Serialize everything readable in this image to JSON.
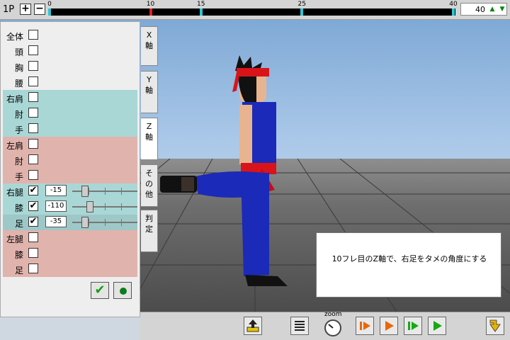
{
  "player": "1P",
  "zoom_in_label": "+",
  "zoom_out_label": "−",
  "timeline": {
    "ticks": [
      {
        "label": "0",
        "frame": 0,
        "color": "#2ec5d6"
      },
      {
        "label": "10",
        "frame": 10,
        "color": "#e02020"
      },
      {
        "label": "15",
        "frame": 15,
        "color": "#2ec5d6"
      },
      {
        "label": "25",
        "frame": 25,
        "color": "#2ec5d6"
      },
      {
        "label": "40",
        "frame": 40,
        "color": "#2ec5d6"
      }
    ],
    "current_frame": "40"
  },
  "panel": {
    "rows": [
      {
        "label": "全体",
        "checked": false
      },
      {
        "label": "頭",
        "checked": false
      },
      {
        "label": "胸",
        "checked": false
      },
      {
        "label": "腰",
        "checked": false
      },
      {
        "label": "右肩",
        "checked": false
      },
      {
        "label": "肘",
        "checked": false
      },
      {
        "label": "手",
        "checked": false
      },
      {
        "label": "左肩",
        "checked": false
      },
      {
        "label": "肘",
        "checked": false
      },
      {
        "label": "手",
        "checked": false
      },
      {
        "label": "右腿",
        "checked": true,
        "value": "-15",
        "slider_fraction": 0.2
      },
      {
        "label": "膝",
        "checked": true,
        "value": "-110",
        "slider_fraction": 0.27
      },
      {
        "label": "足",
        "checked": true,
        "value": "-35",
        "slider_fraction": 0.2
      },
      {
        "label": "左腿",
        "checked": false
      },
      {
        "label": "膝",
        "checked": false
      },
      {
        "label": "足",
        "checked": false
      }
    ],
    "confirm_icon": "checkmark-icon",
    "record_icon": "record-dot-icon"
  },
  "axis_tabs": [
    "X\n軸",
    "Y\n軸",
    "Z\n軸",
    "そ\nの\n他",
    "判\n定"
  ],
  "info_text": "10フレ目のZ軸で、右足をタメの角度にする",
  "bottom": {
    "zoom_label": "zoom",
    "buttons": [
      "export-icon",
      "list-icon",
      "rewind-icon",
      "play-icon",
      "step-forward-icon",
      "play-forward-icon",
      "exit-icon"
    ]
  },
  "colors": {
    "cyan_group": "#a9d7d6",
    "pink_group": "#e1b3ad",
    "active_row": "#9ec8c7"
  }
}
